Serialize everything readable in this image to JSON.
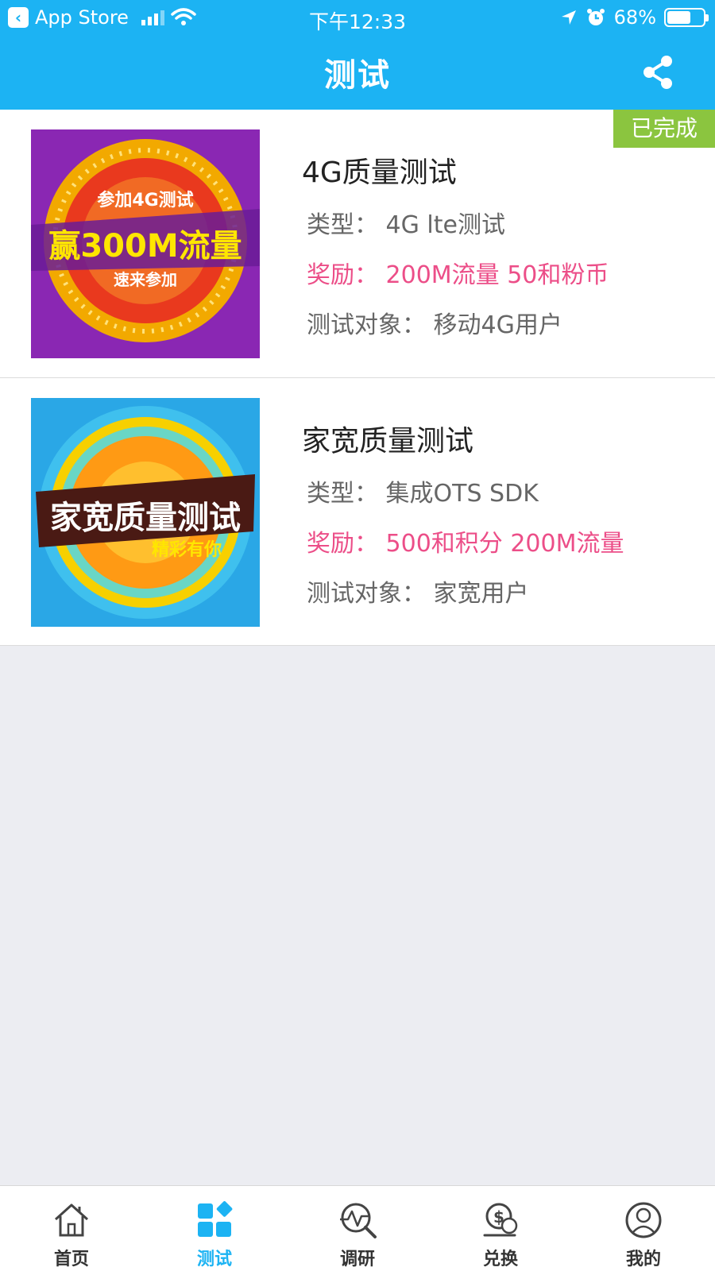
{
  "status": {
    "back_app": "App Store",
    "time": "下午12:33",
    "battery": "68%",
    "battery_level": 0.68
  },
  "nav": {
    "title": "测试"
  },
  "tests": [
    {
      "title": "4G质量测试",
      "type": "类型：  4G lte测试",
      "reward": "奖励：  200M流量 50和粉币",
      "target": "测试对象：  移动4G用户",
      "badge": "已完成",
      "banner": {
        "line1": "参加4G测试",
        "line2": "赢300M流量",
        "line3": "速来参加"
      }
    },
    {
      "title": "家宽质量测试",
      "type": "类型：  集成OTS SDK",
      "reward": "奖励：  500和积分 200M流量",
      "target": "测试对象：  家宽用户",
      "banner": {
        "line1": "家宽质量测试",
        "line2": "精彩有你"
      }
    }
  ],
  "tabs": [
    {
      "label": "首页",
      "icon": "home-icon"
    },
    {
      "label": "测试",
      "icon": "grid-icon",
      "active": true
    },
    {
      "label": "调研",
      "icon": "research-icon"
    },
    {
      "label": "兑换",
      "icon": "coin-icon"
    },
    {
      "label": "我的",
      "icon": "user-icon"
    }
  ],
  "colors": {
    "primary": "#1cb3f3",
    "reward": "#ec4e88",
    "badge": "#8bc53f"
  }
}
